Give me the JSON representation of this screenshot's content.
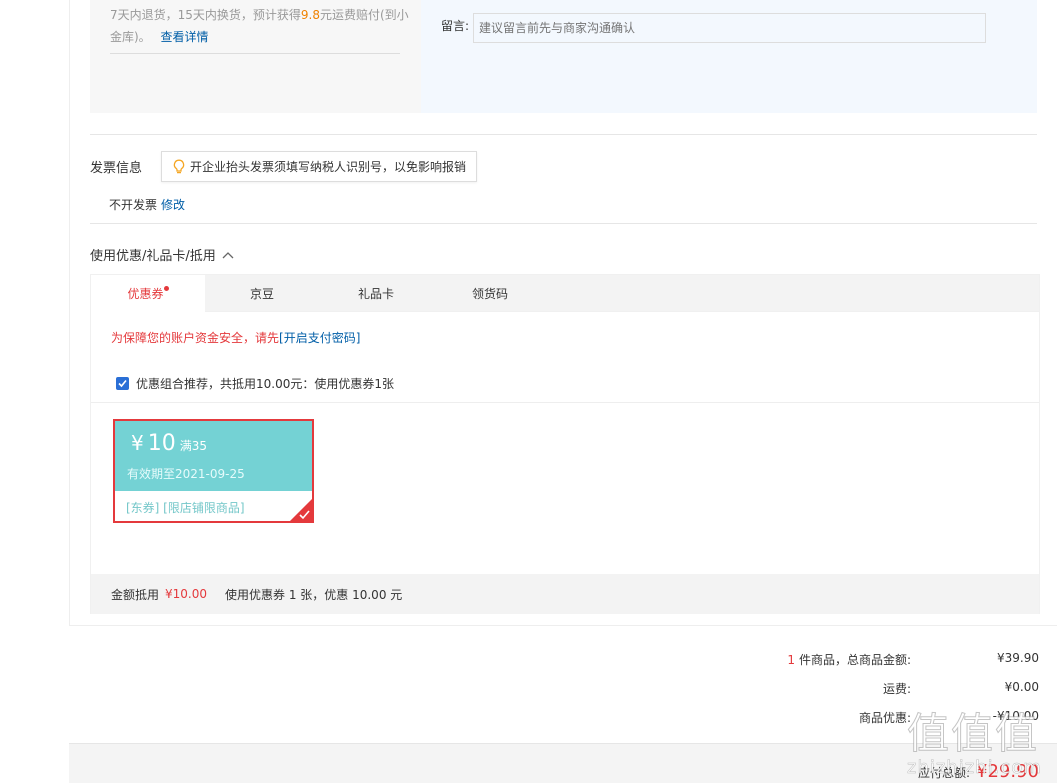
{
  "shipping": {
    "policy_prefix": "7天内退货，15天内换货，预计获得",
    "policy_amount": "9.8",
    "policy_suffix": "元运费赔付(到小金库)。",
    "detail_link": "查看详情",
    "remark_label": "留言:",
    "remark_placeholder": "建议留言前先与商家沟通确认"
  },
  "invoice": {
    "title": "发票信息",
    "tip": "开企业抬头发票须填写纳税人识别号，以免影响报销",
    "status": "不开发票",
    "edit_link": "修改"
  },
  "coupon": {
    "title": "使用优惠/礼品卡/抵用",
    "tabs": [
      {
        "label": "优惠券",
        "active": true
      },
      {
        "label": "京豆",
        "active": false
      },
      {
        "label": "礼品卡",
        "active": false
      },
      {
        "label": "领货码",
        "active": false
      }
    ],
    "warn_text": "为保障您的账户资金安全，请先",
    "warn_link": "[开启支付密码]",
    "combo_text": "优惠组合推荐，共抵用10.00元：使用优惠券1张",
    "card": {
      "yen": "¥",
      "amount": "10",
      "limit": "满35",
      "expire": "有效期至2021-09-25",
      "tags": "[东券]  [限店铺限商品]"
    },
    "summary_label": "金额抵用",
    "summary_amount": "¥10.00",
    "summary_used": "使用优惠券 1 张，优惠 10.00 元"
  },
  "totals": {
    "count": "1",
    "goods_label": "件商品，总商品金额:",
    "goods_value": "¥39.90",
    "freight_label": "运费:",
    "freight_value": "¥0.00",
    "discount_label": "商品优惠:",
    "discount_value": "-¥10.00",
    "pay_label": "应付总额:",
    "pay_value": "¥29.90"
  },
  "watermark": {
    "glyphs": "值值值",
    "site": "zhizhizhi.com"
  },
  "colors": {
    "accent_red": "#e4393c",
    "link_blue": "#005ea7",
    "coupon_teal": "#74d2d4",
    "highlight_orange": "#f08200"
  }
}
